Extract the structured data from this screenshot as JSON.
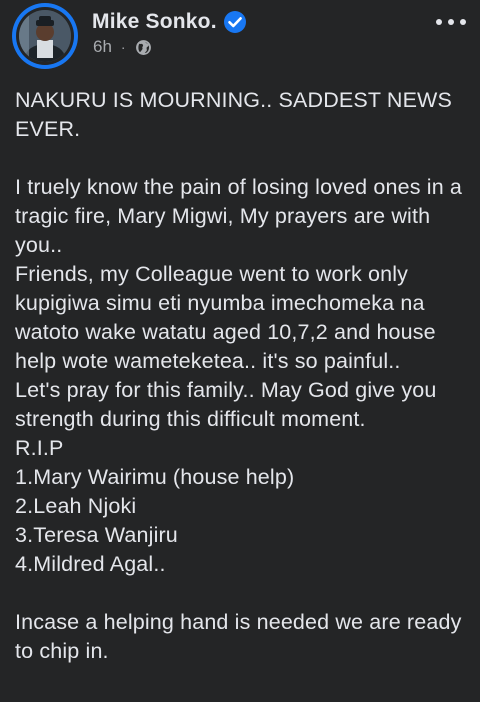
{
  "author": {
    "name": "Mike Sonko.",
    "verified": true,
    "avatar": "profile-photo"
  },
  "meta": {
    "time": "6h",
    "separator": "·",
    "audience_icon": "globe-icon"
  },
  "menu_icon": "more-options-icon",
  "colors": {
    "background": "#242526",
    "text": "#e4e6eb",
    "secondary_text": "#a8abaf",
    "verified_blue": "#1877f2"
  },
  "post": {
    "headline": "NAKURU IS MOURNING.. SADDEST NEWS EVER.",
    "paragraph_lines": [
      "I truely know the pain of losing loved ones in a tragic fire, Mary Migwi, My prayers are with you..",
      "Friends, my Colleague went to work only kupigiwa simu eti nyumba imechomeka na watoto wake watatu aged 10,7,2 and house help wote wameteketea.. it's so painful..",
      "Let's pray for this family.. May God give you strength during this difficult moment.",
      "R.I.P"
    ],
    "victims": [
      "1.Mary Wairimu (house help)",
      "2.Leah Njoki",
      "3.Teresa Wanjiru",
      "4.Mildred Agal.."
    ],
    "closing": "Incase a helping hand is needed we are ready to chip in."
  }
}
